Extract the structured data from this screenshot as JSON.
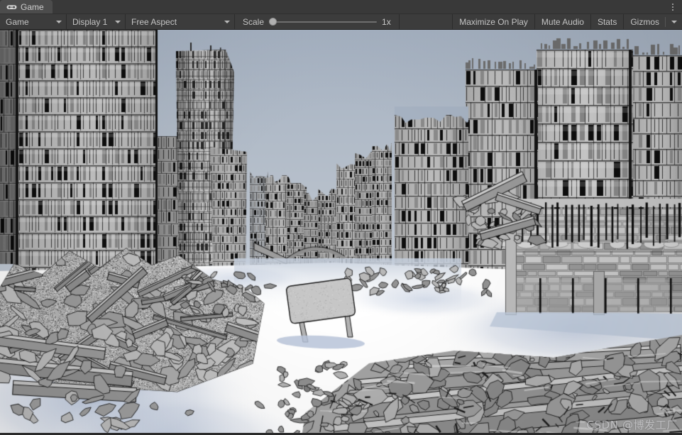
{
  "window": {
    "title": "Game",
    "background_color": "#383838"
  },
  "tab_strip": {
    "background_color": "#393939",
    "tabs": [
      {
        "label": "Game",
        "icon": "gamepad-icon",
        "active": true
      }
    ],
    "overflow_menu_icon": "kebab-menu-icon"
  },
  "toolbar": {
    "background_color": "#3c3c3c",
    "text_color": "#c4c4c4",
    "play_mode_dropdown": {
      "label": "Game",
      "icon": "chevron-down-icon"
    },
    "display_dropdown": {
      "label": "Display 1",
      "icon": "chevron-down-icon"
    },
    "aspect_dropdown": {
      "label": "Free Aspect",
      "icon": "chevron-down-icon"
    },
    "scale": {
      "label": "Scale",
      "value": "1x",
      "slider_percent": 0,
      "min": 1,
      "max": 5
    },
    "maximize_on_play": {
      "label": "Maximize On Play"
    },
    "mute_audio": {
      "label": "Mute Audio"
    },
    "stats": {
      "label": "Stats"
    },
    "gizmos": {
      "label": "Gizmos",
      "icon": "chevron-down-icon"
    }
  },
  "game_view": {
    "scene_description": "Grayscale post-apocalyptic ruined city street with snow-covered ground, collapsed skyscrapers, concrete rubble, fallen beams, a tilted blank billboard sign and a stone retaining wall with vertical posts on the right.",
    "sky_color_top": "#a6b2c2",
    "sky_color_bottom": "#c3cbd6",
    "snow_color": "#ffffff",
    "shadow_color": "#c2cbdb",
    "concrete_light": "#d2d2d2",
    "concrete_mid": "#a8a8a8",
    "concrete_dark": "#6e6e6e",
    "outline_color": "#111111",
    "watermark": "CSDN @博发工厂"
  }
}
